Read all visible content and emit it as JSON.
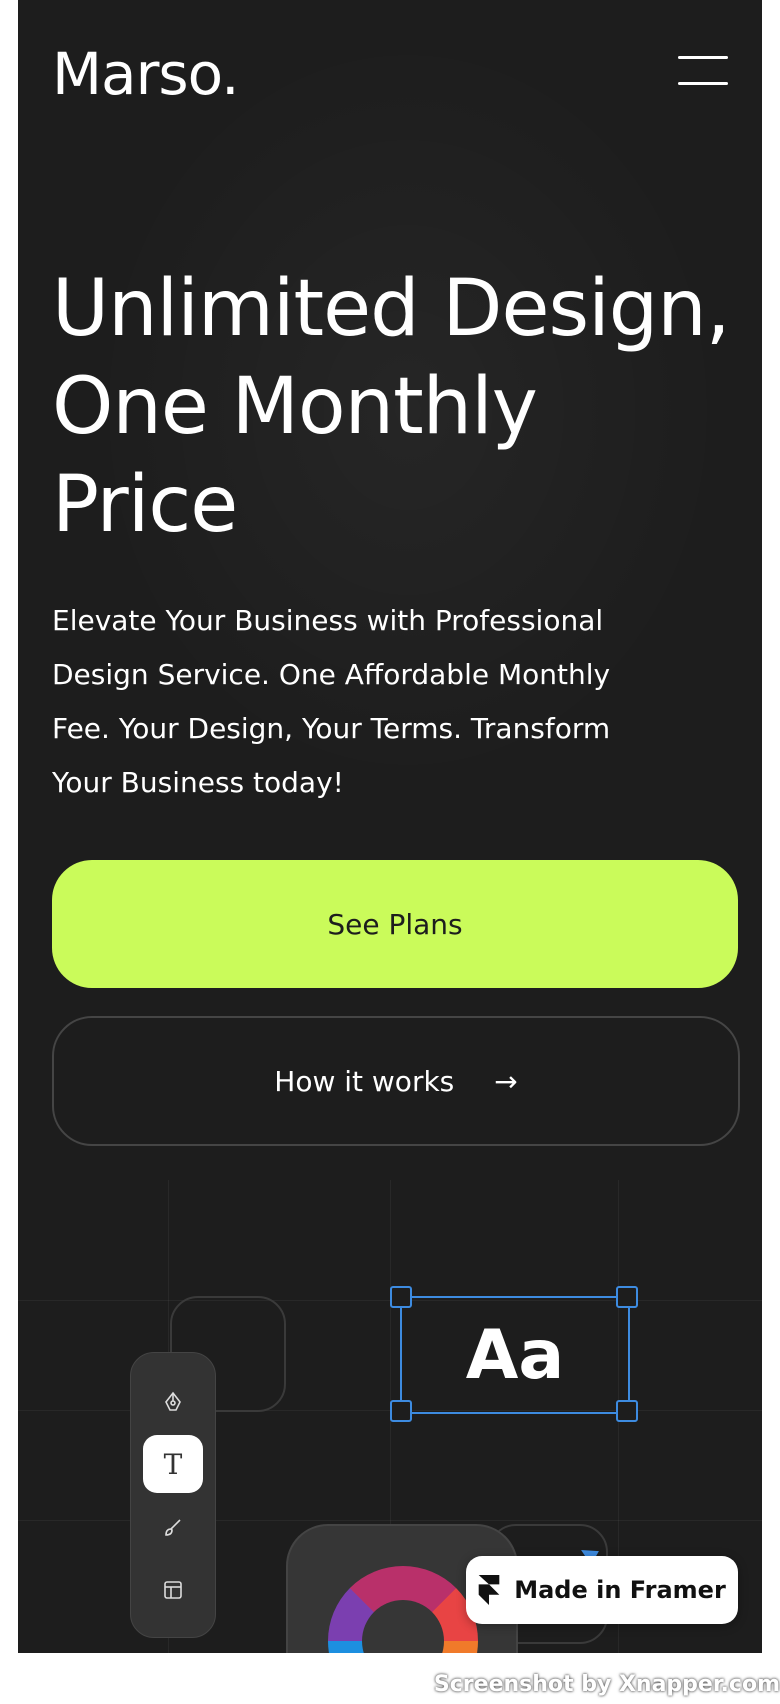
{
  "header": {
    "logo": "Marso.",
    "menu_icon": "hamburger-menu-icon"
  },
  "hero": {
    "title_line1": "Unlimited Design,",
    "title_line2": "One Monthly",
    "title_line3": "Price",
    "subtitle": "Elevate Your Business with Professional Design Service. One Affordable Monthly Fee. Your Design, Your Terms. Transform Your Business today!",
    "primary_cta": "See Plans",
    "secondary_cta": "How it works",
    "secondary_cta_icon": "arrow-right-icon",
    "secondary_cta_arrow": "→"
  },
  "illustration": {
    "text_sample": "Aa",
    "tools": [
      {
        "name": "pen-tool-icon"
      },
      {
        "name": "text-tool-icon",
        "glyph": "T",
        "active": true
      },
      {
        "name": "brush-tool-icon"
      },
      {
        "name": "layout-tool-icon"
      }
    ]
  },
  "badge": {
    "label": "Made in Framer"
  },
  "watermark": "Screenshot by Xnapper.com",
  "colors": {
    "background": "#1d1d1d",
    "accent": "#cafb5a",
    "selection": "#3d8be0",
    "text": "#ffffff"
  }
}
